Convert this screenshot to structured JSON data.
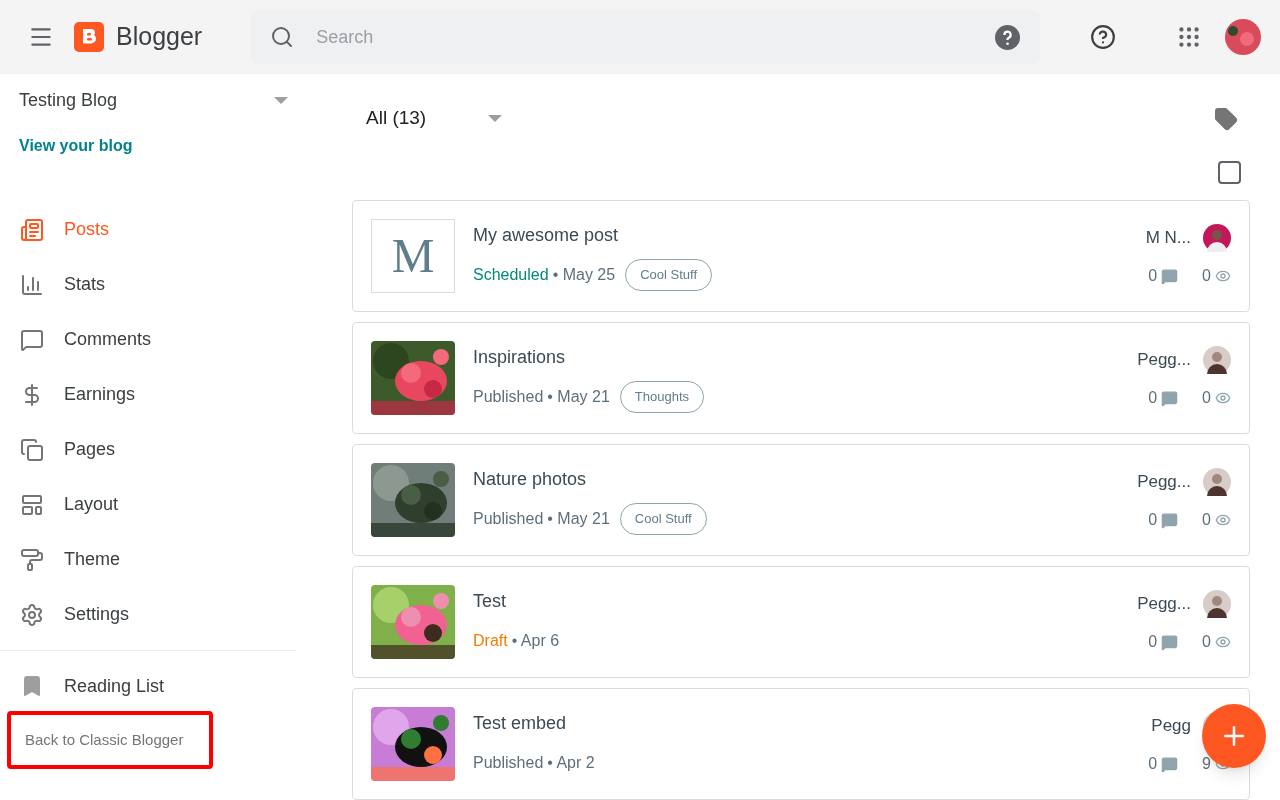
{
  "header": {
    "app_name": "Blogger",
    "search": {
      "placeholder": "Search"
    }
  },
  "sidebar": {
    "blog_name": "Testing Blog",
    "view_link": "View your blog",
    "items": [
      {
        "label": "Posts",
        "selected": true
      },
      {
        "label": "Stats",
        "selected": false
      },
      {
        "label": "Comments",
        "selected": false
      },
      {
        "label": "Earnings",
        "selected": false
      },
      {
        "label": "Pages",
        "selected": false
      },
      {
        "label": "Layout",
        "selected": false
      },
      {
        "label": "Theme",
        "selected": false
      },
      {
        "label": "Settings",
        "selected": false
      }
    ],
    "reading_list": "Reading List",
    "back_link": {
      "label": "Back to Classic Blogger",
      "highlighted": true
    }
  },
  "filter": {
    "label": "All (13)"
  },
  "select_all": {
    "checked": false
  },
  "posts": [
    {
      "title": "My awesome post",
      "thumb": {
        "kind": "letter",
        "letter": "M"
      },
      "status": {
        "text": "Scheduled",
        "color": "#00897b"
      },
      "date": "• May 25",
      "label": "Cool Stuff",
      "author": "M N...",
      "comments": "0",
      "views": "0"
    },
    {
      "title": "Inspirations",
      "status": {
        "text": "Published",
        "color": "#5f6f7a"
      },
      "date": "• May 21",
      "label": "Thoughts",
      "author": "Pegg...",
      "comments": "0",
      "views": "0"
    },
    {
      "title": "Nature photos",
      "status": {
        "text": "Published",
        "color": "#5f6f7a"
      },
      "date": "• May 21",
      "label": "Cool Stuff",
      "author": "Pegg...",
      "comments": "0",
      "views": "0"
    },
    {
      "title": "Test",
      "status": {
        "text": "Draft",
        "color": "#f57c00"
      },
      "date": "• Apr 6",
      "author": "Pegg...",
      "comments": "0",
      "views": "0"
    },
    {
      "title": "Test embed",
      "status": {
        "text": "Published",
        "color": "#5f6f7a"
      },
      "date": "• Apr 2",
      "author": "Pegg",
      "comments": "0",
      "views": "9"
    }
  ]
}
